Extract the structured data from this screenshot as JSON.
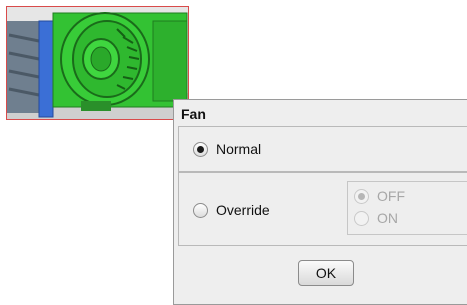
{
  "dialog": {
    "title": "Fan",
    "normal_label": "Normal",
    "override_label": "Override",
    "off_label": "OFF",
    "on_label": "ON",
    "ok_label": "OK",
    "selected_mode": "Normal",
    "selected_override_state": "OFF"
  },
  "colors": {
    "fan_green": "#33c233",
    "housing_blue": "#3b6fd6",
    "image_border": "#d94b4b"
  }
}
